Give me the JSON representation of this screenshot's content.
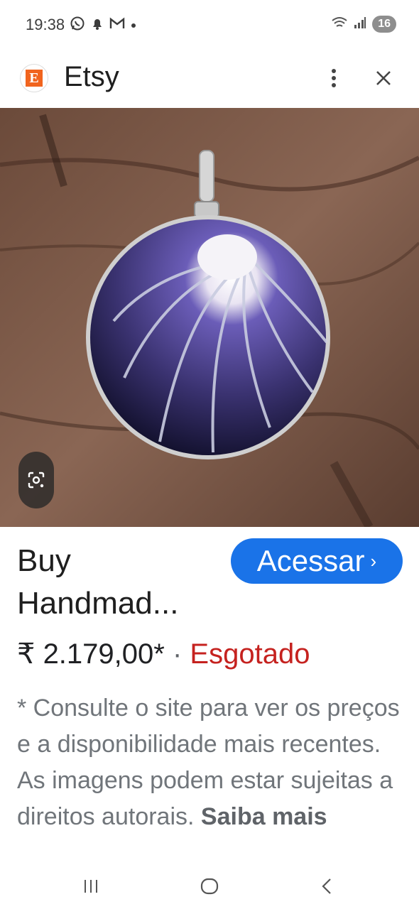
{
  "status_bar": {
    "time": "19:38",
    "left_icons": [
      "whatsapp-icon",
      "notification-bell-icon",
      "gmail-icon",
      "dot-icon"
    ],
    "right_icons": [
      "wifi-icon",
      "signal-icon"
    ],
    "battery": "16"
  },
  "header": {
    "logo_letter": "E",
    "site_name": "Etsy",
    "more_icon": "more-vert-icon",
    "close_icon": "close-icon"
  },
  "image": {
    "alt": "pendant-image",
    "lens_icon": "lens-search-icon"
  },
  "product": {
    "title": "Buy Handmad...",
    "visit_label": "Acessar",
    "price": "₹ 2.179,00*",
    "separator": "·",
    "stock_status": "Esgotado",
    "disclaimer": "* Consulte o site para ver os preços e a disponibilidade mais recentes. As imagens podem estar sujeitas a direitos autorais.",
    "learn_more": "Saiba mais"
  },
  "nav_bar": {
    "icons": [
      "recent-apps-icon",
      "home-icon",
      "back-icon"
    ]
  },
  "colors": {
    "accent": "#1a73e8",
    "out_of_stock": "#c5221f",
    "etsy_orange": "#f1641e"
  }
}
